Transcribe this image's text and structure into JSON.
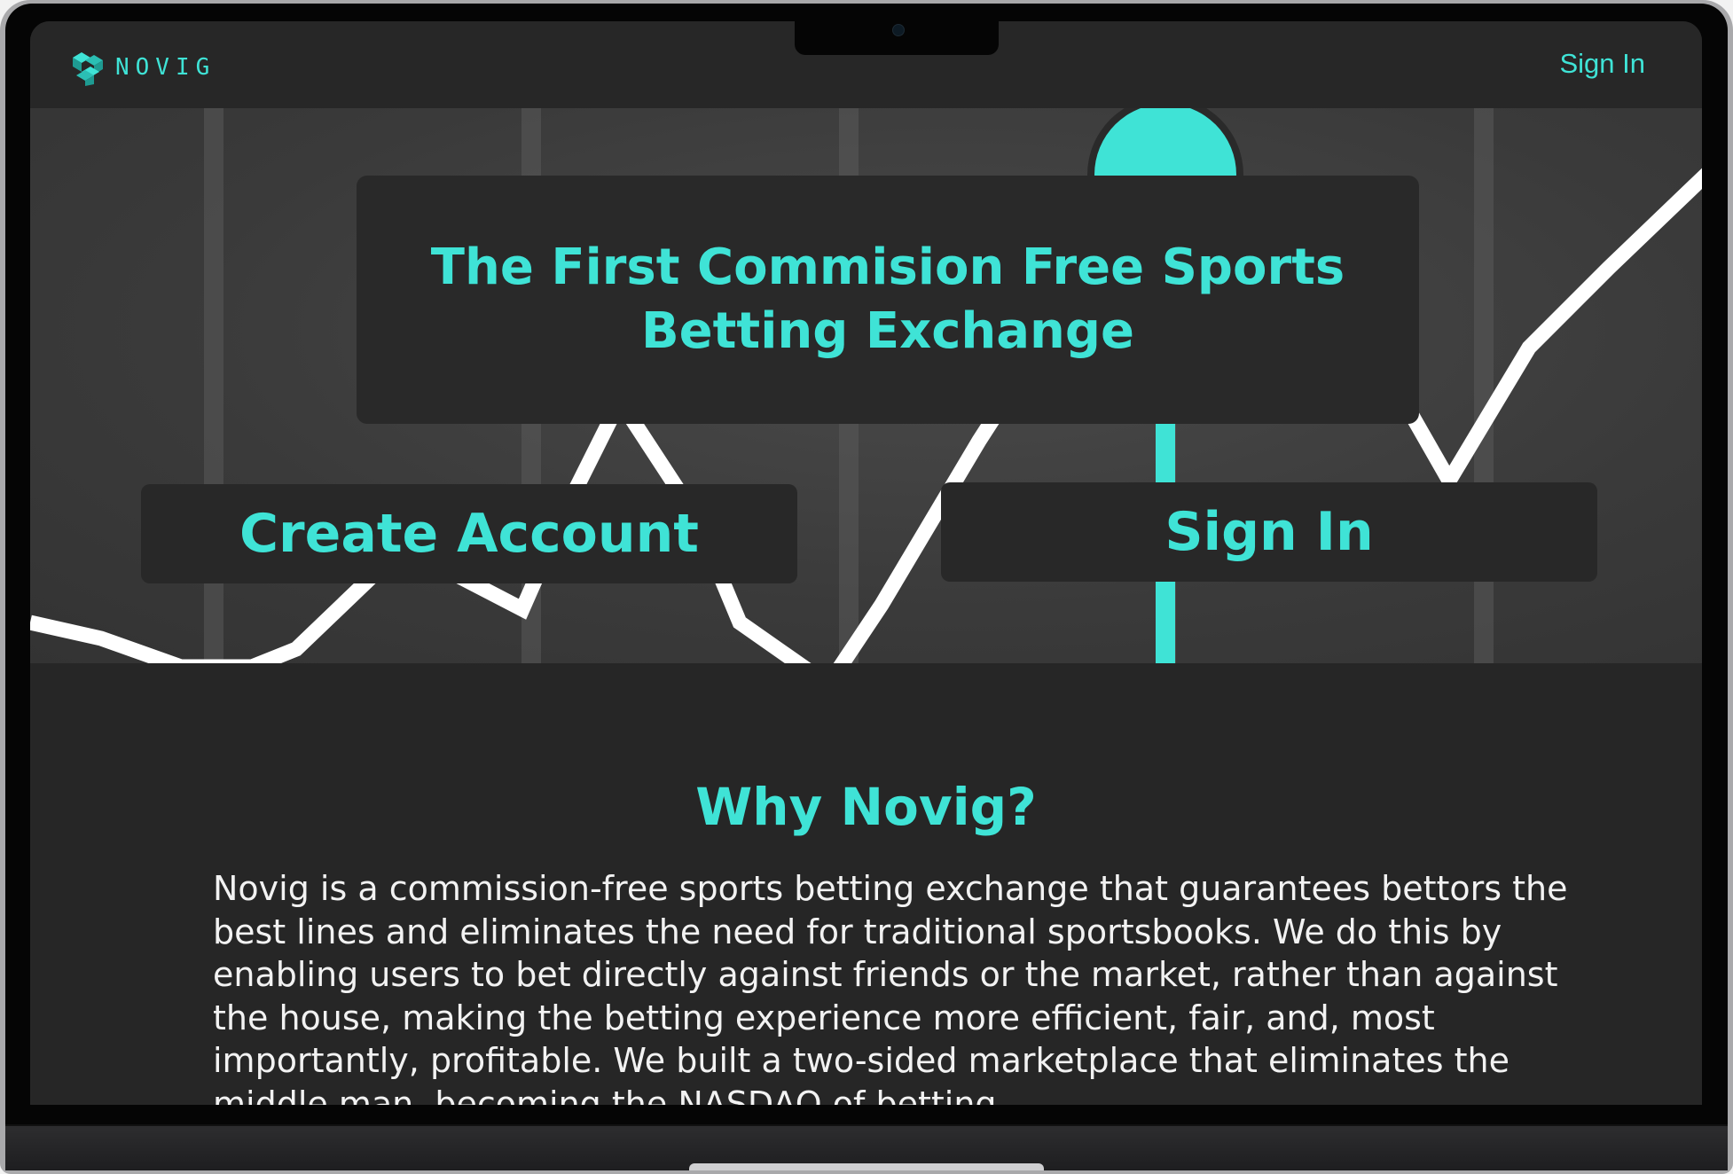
{
  "navbar": {
    "brand_name": "NOVIG",
    "brand_logo_icon": "novig-logo-icon",
    "signin_label": "Sign In"
  },
  "hero": {
    "headline": "The First Commision Free Sports Betting Exchange",
    "create_account_label": "Create Account",
    "signin_label": "Sign In",
    "decoration_icon": "chart-line-graphic"
  },
  "why": {
    "title": "Why Novig?",
    "body": "Novig is a commission-free sports betting exchange that guarantees bettors the best lines and eliminates the need for traditional sportsbooks. We do this by enabling users to bet directly against friends or the market, rather than against the house, making the betting experience more efficient, fair, and, most importantly, profitable. We built a two-sided marketplace that eliminates the middle man, becoming the NASDAQ of betting."
  },
  "colors": {
    "accent": "#3fe3d6",
    "background": "#262626",
    "panel": "#292929",
    "text": "#f2f2f2"
  }
}
